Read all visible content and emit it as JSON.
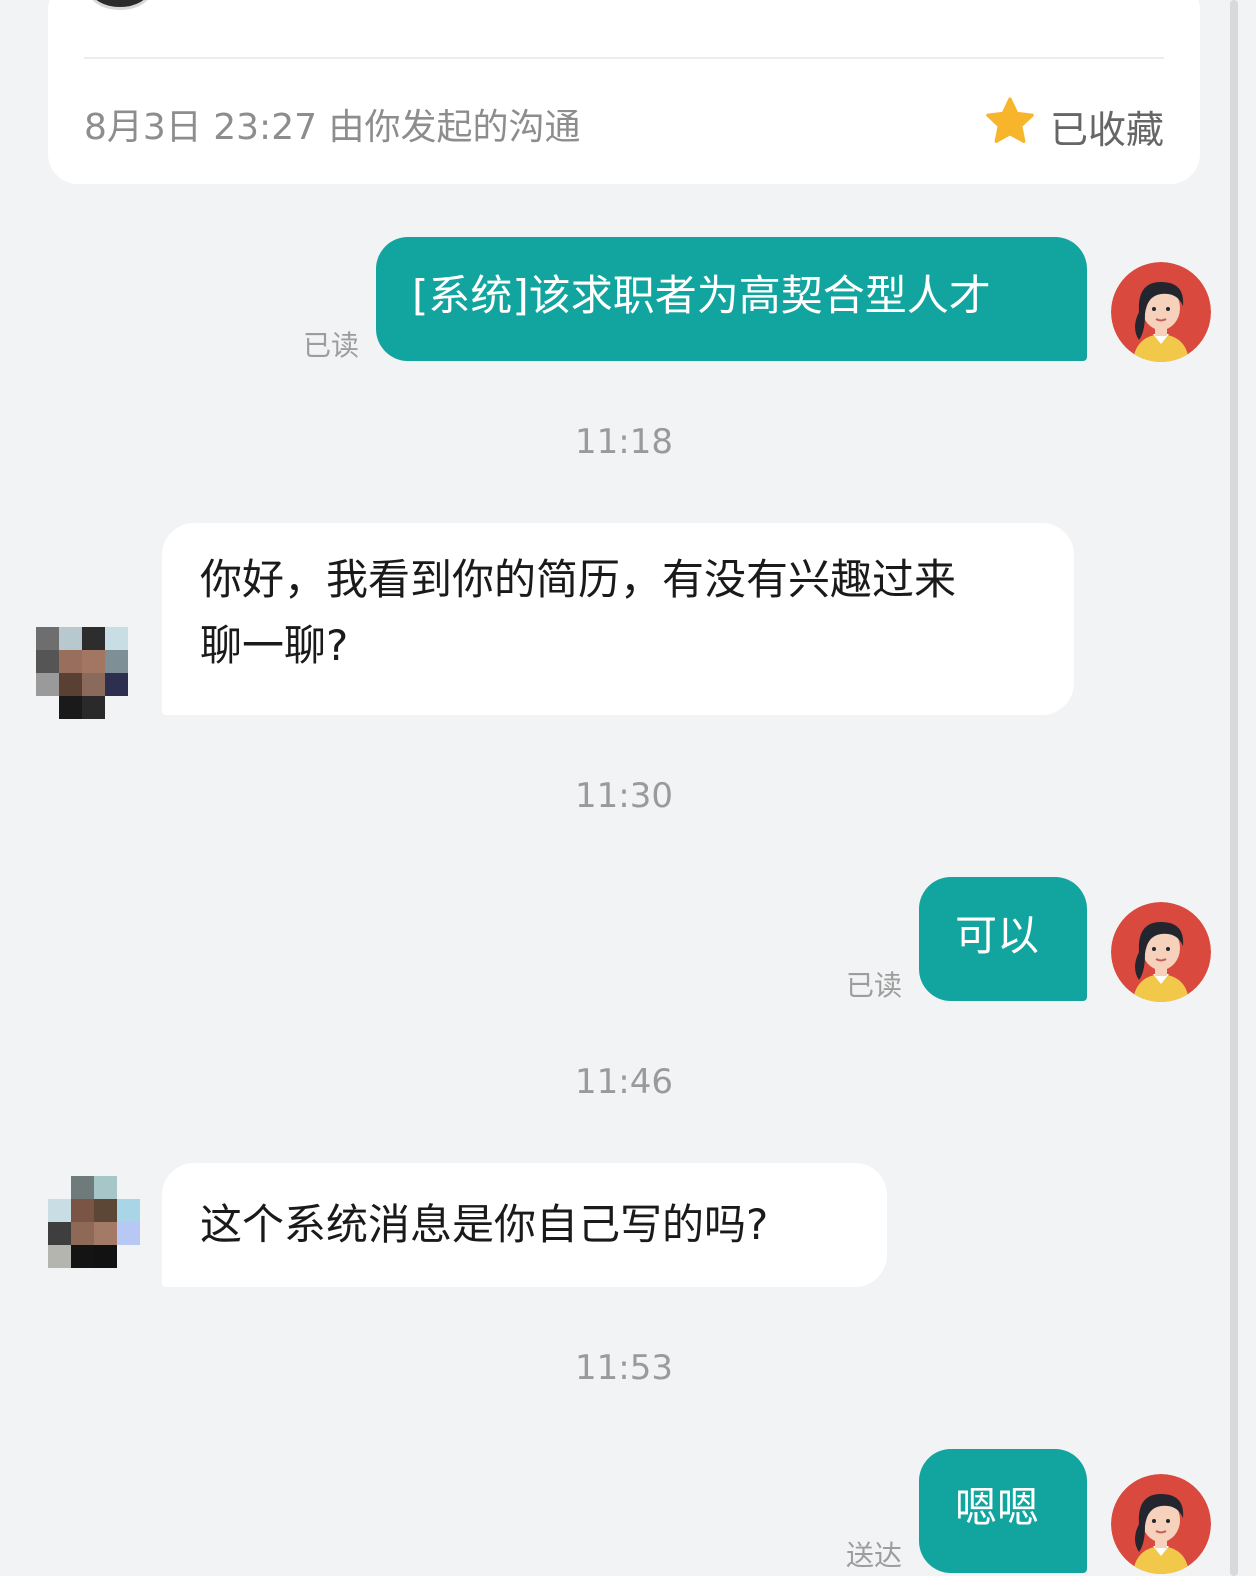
{
  "header": {
    "meta": "8月3日 23:27 由你发起的沟通",
    "favorite_label": "已收藏"
  },
  "messages": [
    {
      "direction": "out",
      "text": "[系统]该求职者为高契合型人才",
      "status": "已读"
    },
    {
      "time": "11:18"
    },
    {
      "direction": "in",
      "line1": "你好，我看到你的简历，有没有兴趣过来",
      "line2": "聊一聊?"
    },
    {
      "time": "11:30"
    },
    {
      "direction": "out",
      "text": "可以",
      "status": "已读"
    },
    {
      "time": "11:46"
    },
    {
      "direction": "in",
      "text": "这个系统消息是你自己写的吗?"
    },
    {
      "time": "11:53"
    },
    {
      "direction": "out",
      "text": "嗯嗯",
      "status": "送达"
    }
  ],
  "colors": {
    "accent": "#12a49e",
    "background": "#f2f3f4",
    "star": "#f7b52c"
  },
  "icons": {
    "favorite": "star-icon",
    "my_avatar": "avatar-woman-illustration",
    "other_avatar": "pixelated-avatar"
  }
}
